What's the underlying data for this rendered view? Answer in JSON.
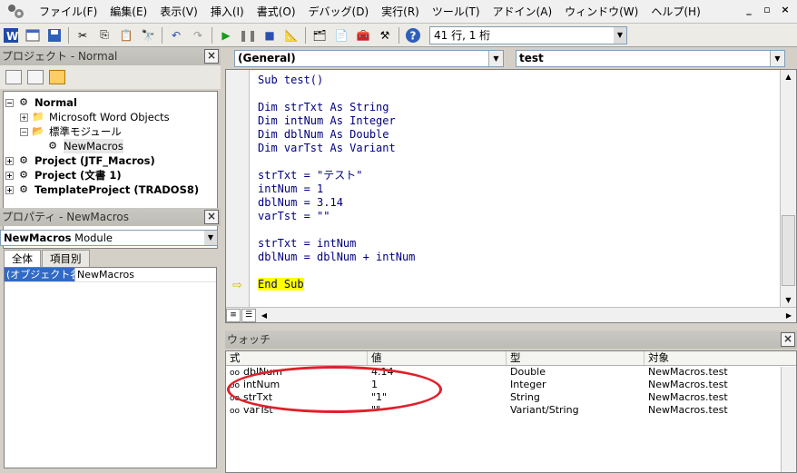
{
  "menu": {
    "items": [
      "ファイル(F)",
      "編集(E)",
      "表示(V)",
      "挿入(I)",
      "書式(O)",
      "デバッグ(D)",
      "実行(R)",
      "ツール(T)",
      "アドイン(A)",
      "ウィンドウ(W)",
      "ヘルプ(H)"
    ]
  },
  "toolbar": {
    "position": "41 行, 1 桁"
  },
  "project": {
    "title": "プロジェクト - Normal",
    "tree": [
      {
        "label": "Normal"
      },
      {
        "label": "Microsoft Word Objects"
      },
      {
        "label": "標準モジュール"
      },
      {
        "label": "NewMacros"
      },
      {
        "label": "Project (JTF_Macros)"
      },
      {
        "label": "Project (文書 1)"
      },
      {
        "label": "TemplateProject (TRADOS8)"
      }
    ]
  },
  "properties": {
    "title": "プロパティ - NewMacros",
    "object_name": "NewMacros",
    "object_type": "Module",
    "tabs": [
      "全体",
      "項目別"
    ],
    "rows": [
      {
        "key": "(オブジェクト名)",
        "value": "NewMacros"
      }
    ]
  },
  "code": {
    "object_combo": "(General)",
    "proc_combo": "test",
    "lines": [
      "Sub test()",
      "",
      "Dim strTxt As String",
      "Dim intNum As Integer",
      "Dim dblNum As Double",
      "Dim varTst As Variant",
      "",
      "strTxt = \"テスト\"",
      "intNum = 1",
      "dblNum = 3.14",
      "varTst = \"\"",
      "",
      "strTxt = intNum",
      "dblNum = dblNum + intNum",
      "",
      "End Sub"
    ]
  },
  "watch": {
    "title": "ウォッチ",
    "columns": [
      "式",
      "値",
      "型",
      "対象"
    ],
    "rows": [
      {
        "expr": "dblNum",
        "value": "4.14",
        "type": "Double",
        "context": "NewMacros.test"
      },
      {
        "expr": "intNum",
        "value": "1",
        "type": "Integer",
        "context": "NewMacros.test"
      },
      {
        "expr": "strTxt",
        "value": "\"1\"",
        "type": "String",
        "context": "NewMacros.test"
      },
      {
        "expr": "varTst",
        "value": "\"\"",
        "type": "Variant/String",
        "context": "NewMacros.test"
      }
    ]
  }
}
